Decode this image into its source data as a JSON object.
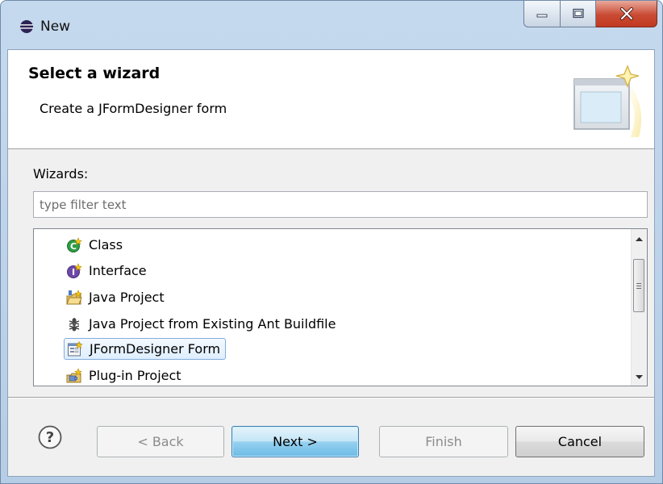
{
  "window": {
    "title": "New",
    "controls": {
      "minimize": "minimize",
      "maximize": "maximize",
      "close": "close"
    }
  },
  "banner": {
    "title": "Select a wizard",
    "subtitle": "Create a JFormDesigner form",
    "image_icon": "new-wizard-banner-icon"
  },
  "wizards": {
    "label": "Wizards:",
    "filter_placeholder": "type filter text",
    "filter_value": "",
    "items": [
      {
        "label": "Class",
        "icon": "class-icon"
      },
      {
        "label": "Interface",
        "icon": "interface-icon"
      },
      {
        "label": "Java Project",
        "icon": "java-project-icon"
      },
      {
        "label": "Java Project from Existing Ant Buildfile",
        "icon": "ant-icon"
      },
      {
        "label": "JFormDesigner Form",
        "icon": "jformdesigner-form-icon",
        "selected": true
      },
      {
        "label": "Plug-in Project",
        "icon": "plugin-project-icon"
      }
    ]
  },
  "buttons": {
    "back": "< Back",
    "next": "Next >",
    "finish": "Finish",
    "cancel": "Cancel"
  },
  "colors": {
    "selection_border": "#84acdd",
    "default_button": "#6cbbe6",
    "close_button": "#c94a33"
  }
}
